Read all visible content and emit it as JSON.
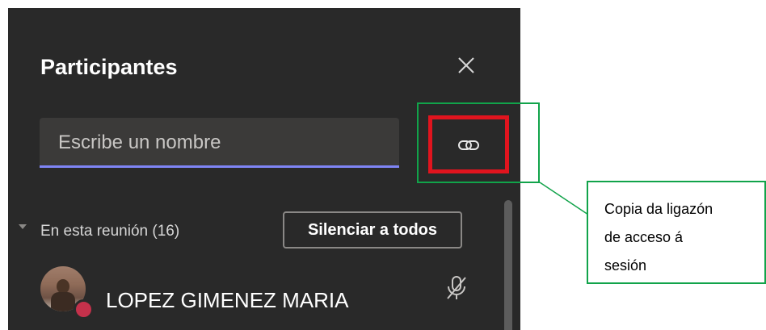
{
  "panel": {
    "title": "Participantes",
    "close_icon": "close-icon",
    "search": {
      "placeholder": "Escribe un nombre",
      "value": ""
    },
    "copy_link_icon": "link-icon",
    "section": {
      "label": "En esta reunión (16)",
      "mute_all_label": "Silenciar a todos"
    },
    "participants": [
      {
        "name": "LOPEZ GIMENEZ MARIA",
        "mic_icon": "mic-off-icon",
        "status_color": "#c4314b"
      }
    ]
  },
  "callout": {
    "lines": [
      "Copia da ligazón",
      "de acceso á",
      "sesión"
    ],
    "border_color": "#11a34a"
  },
  "highlight_color": "#e0141e",
  "accent_color": "#7f85f5"
}
